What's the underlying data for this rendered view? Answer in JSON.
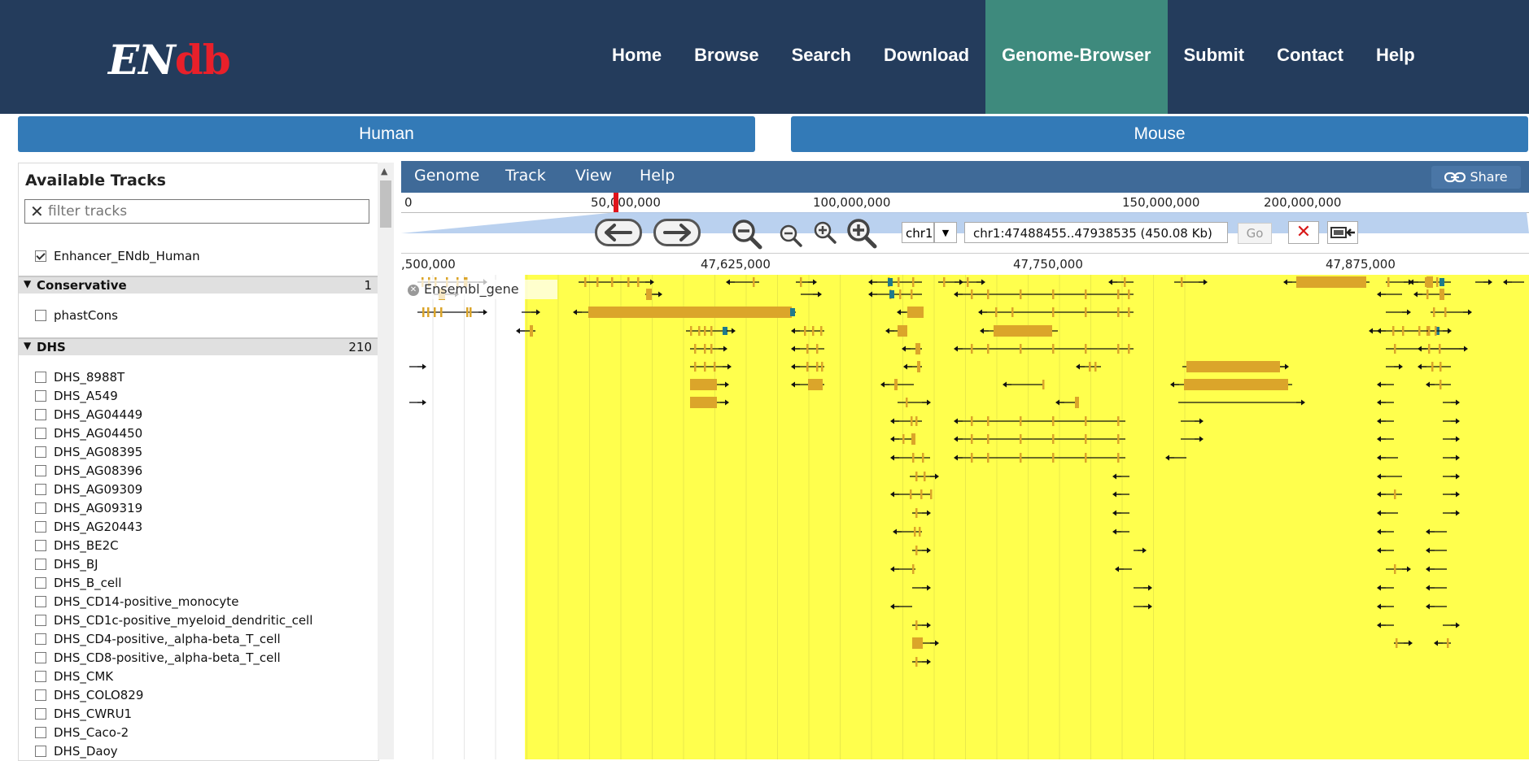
{
  "header": {
    "logo_en": "EN",
    "logo_db": "db",
    "nav": [
      "Home",
      "Browse",
      "Search",
      "Download",
      "Genome-Browser",
      "Submit",
      "Contact",
      "Help"
    ],
    "active_nav": "Genome-Browser"
  },
  "species_tabs": [
    "Human",
    "Mouse"
  ],
  "tracks_panel": {
    "title": "Available Tracks",
    "filter_placeholder": "filter tracks",
    "selected_track": "Enhancer_ENdb_Human",
    "categories": [
      {
        "name": "Conservative",
        "count": "1",
        "items": [
          "phastCons"
        ]
      },
      {
        "name": "DHS",
        "count": "210",
        "items": [
          "DHS_8988T",
          "DHS_A549",
          "DHS_AG04449",
          "DHS_AG04450",
          "DHS_AG08395",
          "DHS_AG08396",
          "DHS_AG09309",
          "DHS_AG09319",
          "DHS_AG20443",
          "DHS_BE2C",
          "DHS_BJ",
          "DHS_B_cell",
          "DHS_CD14-positive_monocyte",
          "DHS_CD1c-positive_myeloid_dendritic_cell",
          "DHS_CD4-positive,_alpha-beta_T_cell",
          "DHS_CD8-positive,_alpha-beta_T_cell",
          "DHS_CMK",
          "DHS_COLO829",
          "DHS_CWRU1",
          "DHS_Caco-2",
          "DHS_Daoy"
        ]
      }
    ]
  },
  "browser": {
    "menu": [
      "Genome",
      "Track",
      "View",
      "Help"
    ],
    "share_label": "Share",
    "overview_labels": [
      "0",
      "50,000,000",
      "100,000,000",
      "150,000,000",
      "200,000,000"
    ],
    "chrom": "chr1",
    "location": "chr1:47488455..47938535 (450.08 Kb)",
    "go_label": "Go",
    "ruler_labels": [
      ",500,000",
      "47,625,000",
      "47,750,000",
      "47,875,000"
    ],
    "track_label": "Ensembl_gene",
    "icons": [
      "left-arrow-icon",
      "right-arrow-icon",
      "zoom-out-big-icon",
      "zoom-out-small-icon",
      "zoom-in-small-icon",
      "zoom-in-big-icon",
      "clear-highlight-icon",
      "highlight-icon",
      "link-icon"
    ],
    "colors": {
      "highlight": "#ffff4d",
      "gene": "#dba52a",
      "utr": "#1f7a8c",
      "menubar": "#3f6a98",
      "header": "#243c5c"
    }
  }
}
